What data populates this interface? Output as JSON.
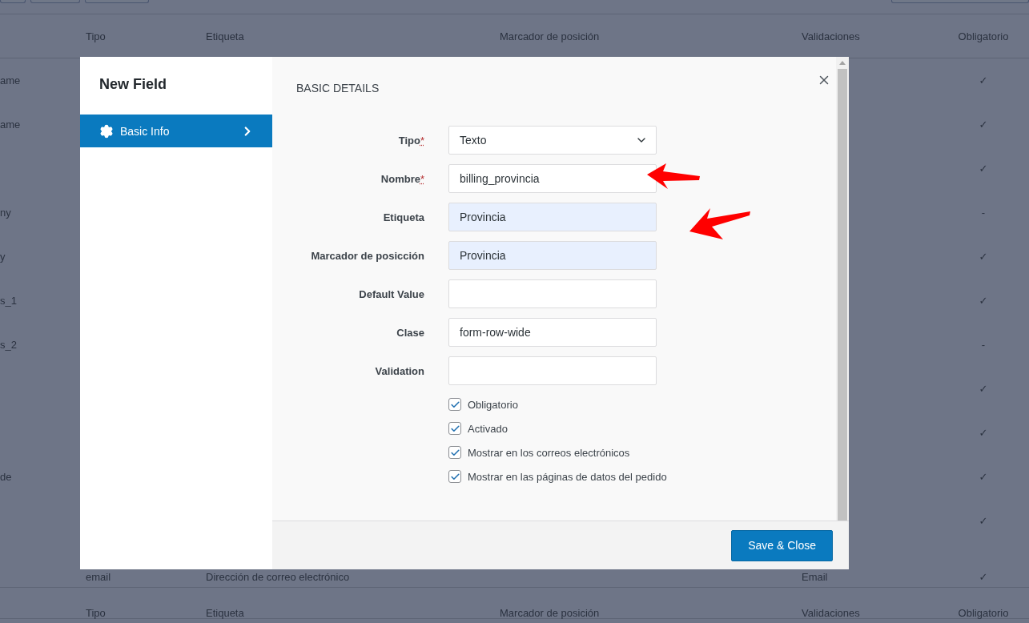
{
  "table": {
    "columns": [
      "Tipo",
      "Etiqueta",
      "Marcador de posición",
      "Validaciones",
      "Obligatorio"
    ],
    "rows": [
      {
        "name": "ame",
        "type": "",
        "label": "",
        "validation": "",
        "required": "✓"
      },
      {
        "name": "ame",
        "type": "",
        "label": "",
        "validation": "",
        "required": "✓"
      },
      {
        "name": "",
        "type": "",
        "label": "",
        "validation": "",
        "required": "✓"
      },
      {
        "name": "ny",
        "type": "",
        "label": "",
        "validation": "",
        "required": "-"
      },
      {
        "name": "y",
        "type": "",
        "label": "",
        "validation": "",
        "required": "✓"
      },
      {
        "name": "s_1",
        "type": "",
        "label": "",
        "validation": "",
        "required": "✓"
      },
      {
        "name": "s_2",
        "type": "",
        "label": "",
        "validation": "",
        "required": "-"
      },
      {
        "name": "",
        "type": "",
        "label": "",
        "validation": "",
        "required": "✓"
      },
      {
        "name": "",
        "type": "",
        "label": "",
        "validation": "",
        "required": "✓"
      },
      {
        "name": "de",
        "type": "",
        "label": "",
        "validation": "",
        "required": "✓"
      },
      {
        "name": "",
        "type": "",
        "label": "",
        "validation": "",
        "required": "✓"
      },
      {
        "name": "",
        "type": "email",
        "label": "Dirección de correo electrónico",
        "validation": "Email",
        "required": "✓"
      }
    ],
    "footer_columns": [
      "Tipo",
      "Etiqueta",
      "Marcador de posición",
      "Validaciones",
      "Obligatorio"
    ]
  },
  "dialog": {
    "title": "New Field",
    "sidebar": [
      {
        "label": "Basic Info",
        "selected": true
      }
    ],
    "section_title": "BASIC DETAILS",
    "fields": [
      {
        "label": "Tipo",
        "required_mark": "*",
        "kind": "select",
        "value": "Texto",
        "autofilled": false
      },
      {
        "label": "Nombre",
        "required_mark": "*",
        "kind": "text",
        "value": "billing_provincia",
        "autofilled": false
      },
      {
        "label": "Etiqueta",
        "kind": "text",
        "value": "Provincia",
        "autofilled": true
      },
      {
        "label": "Marcador de posicción",
        "kind": "text",
        "value": "Provincia",
        "autofilled": true
      },
      {
        "label": "Default Value",
        "kind": "text",
        "autofilled": false
      },
      {
        "label": "Clase",
        "kind": "text",
        "value": "form-row-wide",
        "autofilled": false
      },
      {
        "label": "Validation",
        "kind": "text",
        "autofilled": false
      }
    ],
    "checkboxes": [
      {
        "label": "Obligatorio",
        "checked": true
      },
      {
        "label": "Activado",
        "checked": true
      },
      {
        "label": "Mostrar en los correos electrónicos",
        "checked": true
      },
      {
        "label": "Mostrar en las páginas de datos del pedido",
        "checked": true
      }
    ],
    "save_button": "Save & Close"
  }
}
